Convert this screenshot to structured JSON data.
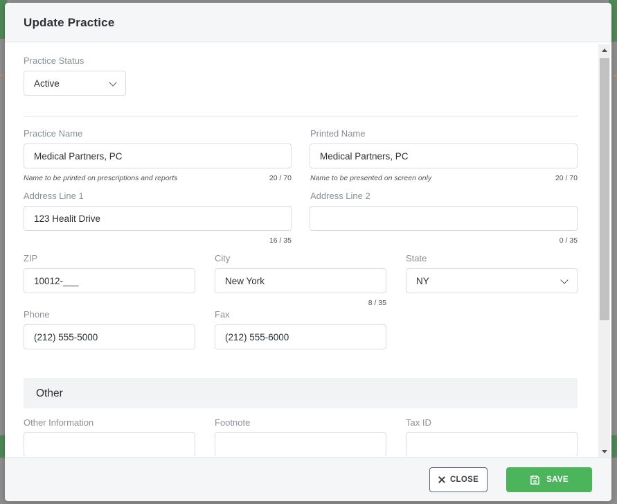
{
  "modal": {
    "title": "Update Practice"
  },
  "form": {
    "practice_status": {
      "label": "Practice Status",
      "value": "Active"
    },
    "practice_name": {
      "label": "Practice Name",
      "value": "Medical Partners, PC",
      "hint": "Name to be printed on prescriptions and reports",
      "counter": "20 / 70"
    },
    "printed_name": {
      "label": "Printed Name",
      "value": "Medical Partners, PC",
      "hint": "Name to be presented on screen only",
      "counter": "20 / 70"
    },
    "address_line_1": {
      "label": "Address Line 1",
      "value": "123 Healit Drive",
      "counter": "16 / 35"
    },
    "address_line_2": {
      "label": "Address Line 2",
      "value": "",
      "counter": "0 / 35"
    },
    "zip": {
      "label": "ZIP",
      "value": "10012-___"
    },
    "city": {
      "label": "City",
      "value": "New York",
      "counter": "8 / 35"
    },
    "state": {
      "label": "State",
      "value": "NY"
    },
    "phone": {
      "label": "Phone",
      "value": "(212) 555-5000"
    },
    "fax": {
      "label": "Fax",
      "value": "(212) 555-6000"
    }
  },
  "other_section": {
    "title": "Other",
    "other_information": {
      "label": "Other Information",
      "value": ""
    },
    "footnote": {
      "label": "Footnote",
      "value": ""
    },
    "tax_id": {
      "label": "Tax ID",
      "value": ""
    }
  },
  "footer": {
    "close_label": "CLOSE",
    "save_label": "SAVE"
  },
  "colors": {
    "accent_green": "#4cb45a",
    "label_gray": "#8a9097"
  },
  "icons": {
    "close": "close-icon",
    "save": "floppy-disk-icon",
    "dropdown": "chevron-down-icon"
  }
}
